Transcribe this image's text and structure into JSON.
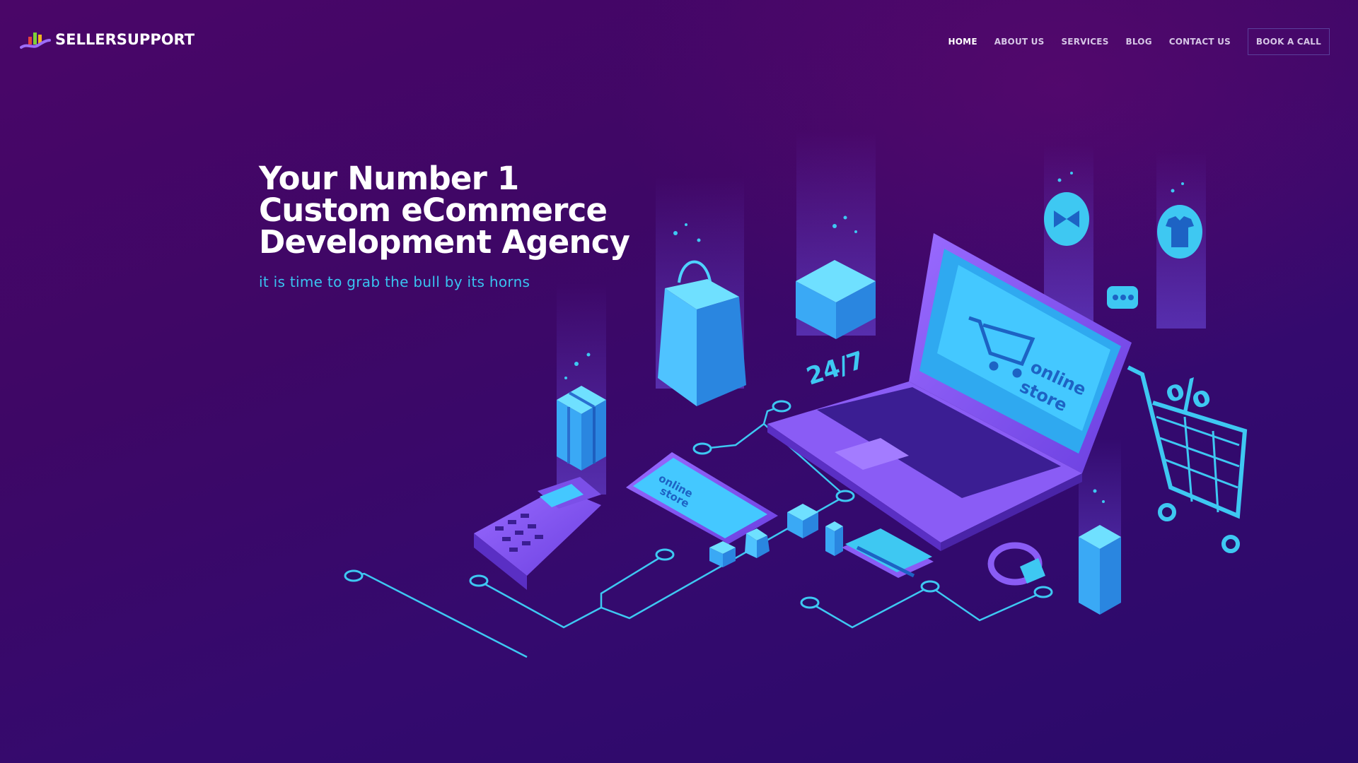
{
  "brand": {
    "name": "SELLERSUPPORT",
    "logo_icon": "bar-chart-swoosh-icon"
  },
  "nav": {
    "items": [
      {
        "label": "HOME",
        "active": true
      },
      {
        "label": "ABOUT US",
        "active": false
      },
      {
        "label": "SERVICES",
        "active": false
      },
      {
        "label": "BLOG",
        "active": false
      },
      {
        "label": "CONTACT US",
        "active": false
      }
    ],
    "cta_label": "BOOK A CALL"
  },
  "hero": {
    "title_lines": [
      "Your Number 1",
      "Custom eCommerce",
      "Development Agency"
    ],
    "subtitle": "it is time to grab the bull by its horns"
  },
  "illustration": {
    "laptop_screen_text": [
      "online",
      "store"
    ],
    "tablet_screen_text": [
      "online",
      "store"
    ],
    "availability_label": "24/7",
    "discount_symbol": "%"
  },
  "colors": {
    "background_top": "#4a0668",
    "background_bottom": "#2a0a6a",
    "accent_cyan": "#39c3f0",
    "accent_purple": "#8a5cf5"
  }
}
